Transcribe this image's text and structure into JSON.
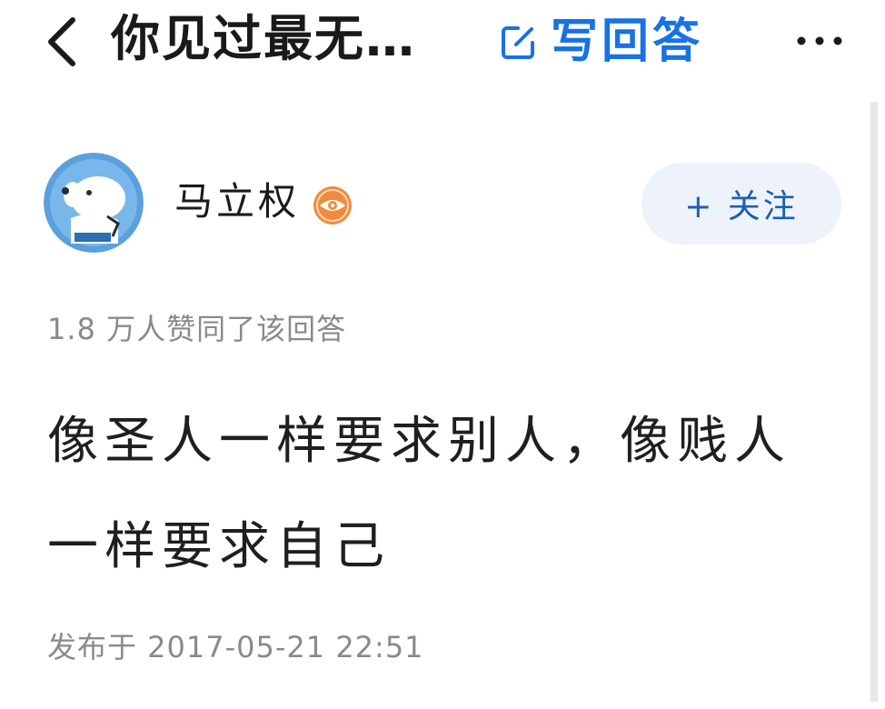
{
  "nav": {
    "back_icon": "chevron-left-icon",
    "title": "你见过最无…",
    "write_answer_icon": "edit-icon",
    "write_answer_label": "写回答",
    "more_icon": "more-horizontal-icon"
  },
  "author": {
    "name": "马立权",
    "avatar_icon": "dog-astronaut-avatar",
    "badge_icon": "eye-badge-icon",
    "follow_label": "+ 关注"
  },
  "answer": {
    "upvote_text": "1.8 万人赞同了该回答",
    "content": "像圣人一样要求别人，像贱人一样要求自己",
    "publish_time": "发布于 2017-05-21 22:51"
  },
  "colors": {
    "accent": "#1772e6",
    "follow_bg": "#eef3fb",
    "follow_text": "#1a5fb4",
    "meta_text": "#8a8a8a",
    "badge_orange": "#f08a3c"
  }
}
